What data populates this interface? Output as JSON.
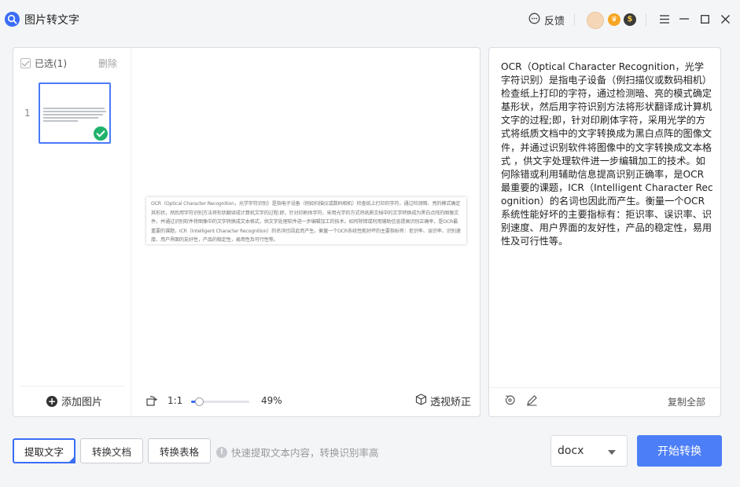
{
  "app": {
    "title": "图片转文字"
  },
  "header": {
    "feedback_label": "反馈",
    "badge_vip": "♛",
    "badge_coin": "$"
  },
  "thumbnails": {
    "select_all_label": "已选(1)",
    "delete_label": "删除",
    "items": [
      {
        "index": "1",
        "selected": true
      }
    ],
    "add_image_label": "添加图片"
  },
  "preview": {
    "document_text": "OCR（Optical Character Recognition，光学字符识别）是指电子设备（例如扫描仪或数码相机）检查纸上打印的字符，通过检测暗、亮的模式确定其形状，然后用字符识别方法将形状翻译成计算机文字的过程;即，针对印刷体字符，采用光学的方式将纸质文档中的文字转换成为黑白点阵的图像文件，并通过识别软件将图像中的文字转换成文本格式，供文字处理软件进一步编辑加工的技术。如何除错或利用辅助信息提高识别正确率，是OCR最重要的课题，ICR（Intelligent Character Recognition）的名词也因此而产生。衡量一个OCR系统性能好坏的主要指标有：拒识率、误识率、识别速度、用户界面的友好性，产品的稳定性，易用性及可行性等。",
    "zoom_reset_label": "1:1",
    "zoom_level": 0.49,
    "zoom_percent": "49%",
    "perspective_label": "透视矫正"
  },
  "result": {
    "text": "OCR（Optical Character Recognition，光学字符识别）是指电子设备（例扫描仪或数码相机）检查纸上打印的字符，通过检测暗、亮的模式确定基形状，然后用字符识别方法将形状翻译成计算机文字的过程;即，针对印刷体字符，采用光学的方式将纸质文档中的文字转换成为黑白点阵的图像文件，并通过识别软件将图像中的文字转换成文本格式 ，供文字处理软件进一步编辑加工的技术。如何除错或利用辅助信息提高识别正确率，是OCR最重要的课题，ICR（Intelligent Character Recognition）的名词也因此而产生。衡量一个OCR系统性能好坏的主要指标有：拒识率、误识率、识别速度、用户界面的友好性，产品的稳定性，易用性及可行性等。",
    "copy_all_label": "复制全部"
  },
  "bottom": {
    "modes": [
      "提取文字",
      "转换文档",
      "转换表格"
    ],
    "active_mode": 0,
    "hint": "快速提取文本内容，转换识别率高",
    "format_value": "docx",
    "start_label": "开始转换"
  },
  "colors": {
    "accent": "#3b6cf6",
    "start_button": "#4c7ef7",
    "check_green": "#20b26b"
  }
}
